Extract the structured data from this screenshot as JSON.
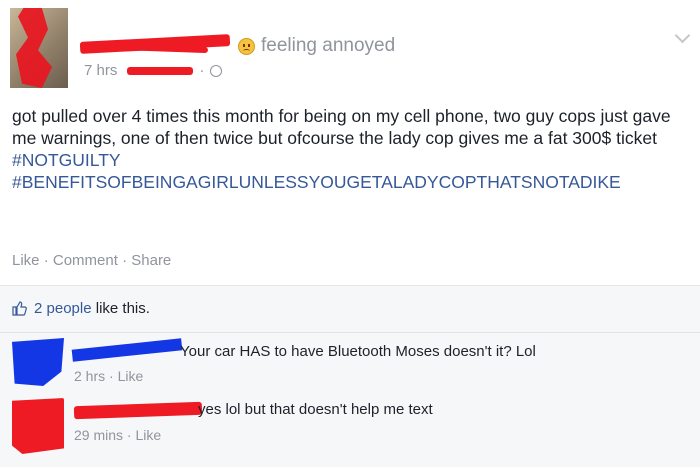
{
  "post": {
    "feeling": "feeling annoyed",
    "time": "7 hrs",
    "privacy_icon": "globe-icon",
    "body": "got pulled over 4 times this month for being on my cell phone, two guy cops just gave me warnings, one of then twice but ofcourse the lady cop gives me a fat 300$ ticket ",
    "hashtag1": "#NOTGUILTY",
    "hashtag2": "#BENEFITSOFBEINGAGIRLUNLESSYOUGETALADYCOPTHATSNOTADIKE",
    "actions": {
      "like": "Like",
      "comment": "Comment",
      "share": "Share",
      "sep": "·"
    }
  },
  "likes": {
    "count_text": "2 people",
    "suffix": " like this."
  },
  "comments": [
    {
      "text": "Your car HAS to have Bluetooth Moses doesn't it? Lol",
      "time": "2 hrs",
      "like": "Like"
    },
    {
      "text": "yes lol but that doesn't help me text",
      "time": "29 mins",
      "like": "Like"
    }
  ],
  "colors": {
    "link": "#365899",
    "meta": "#90949c",
    "redaction_red": "#ee1b24",
    "redaction_blue": "#1437e6"
  }
}
